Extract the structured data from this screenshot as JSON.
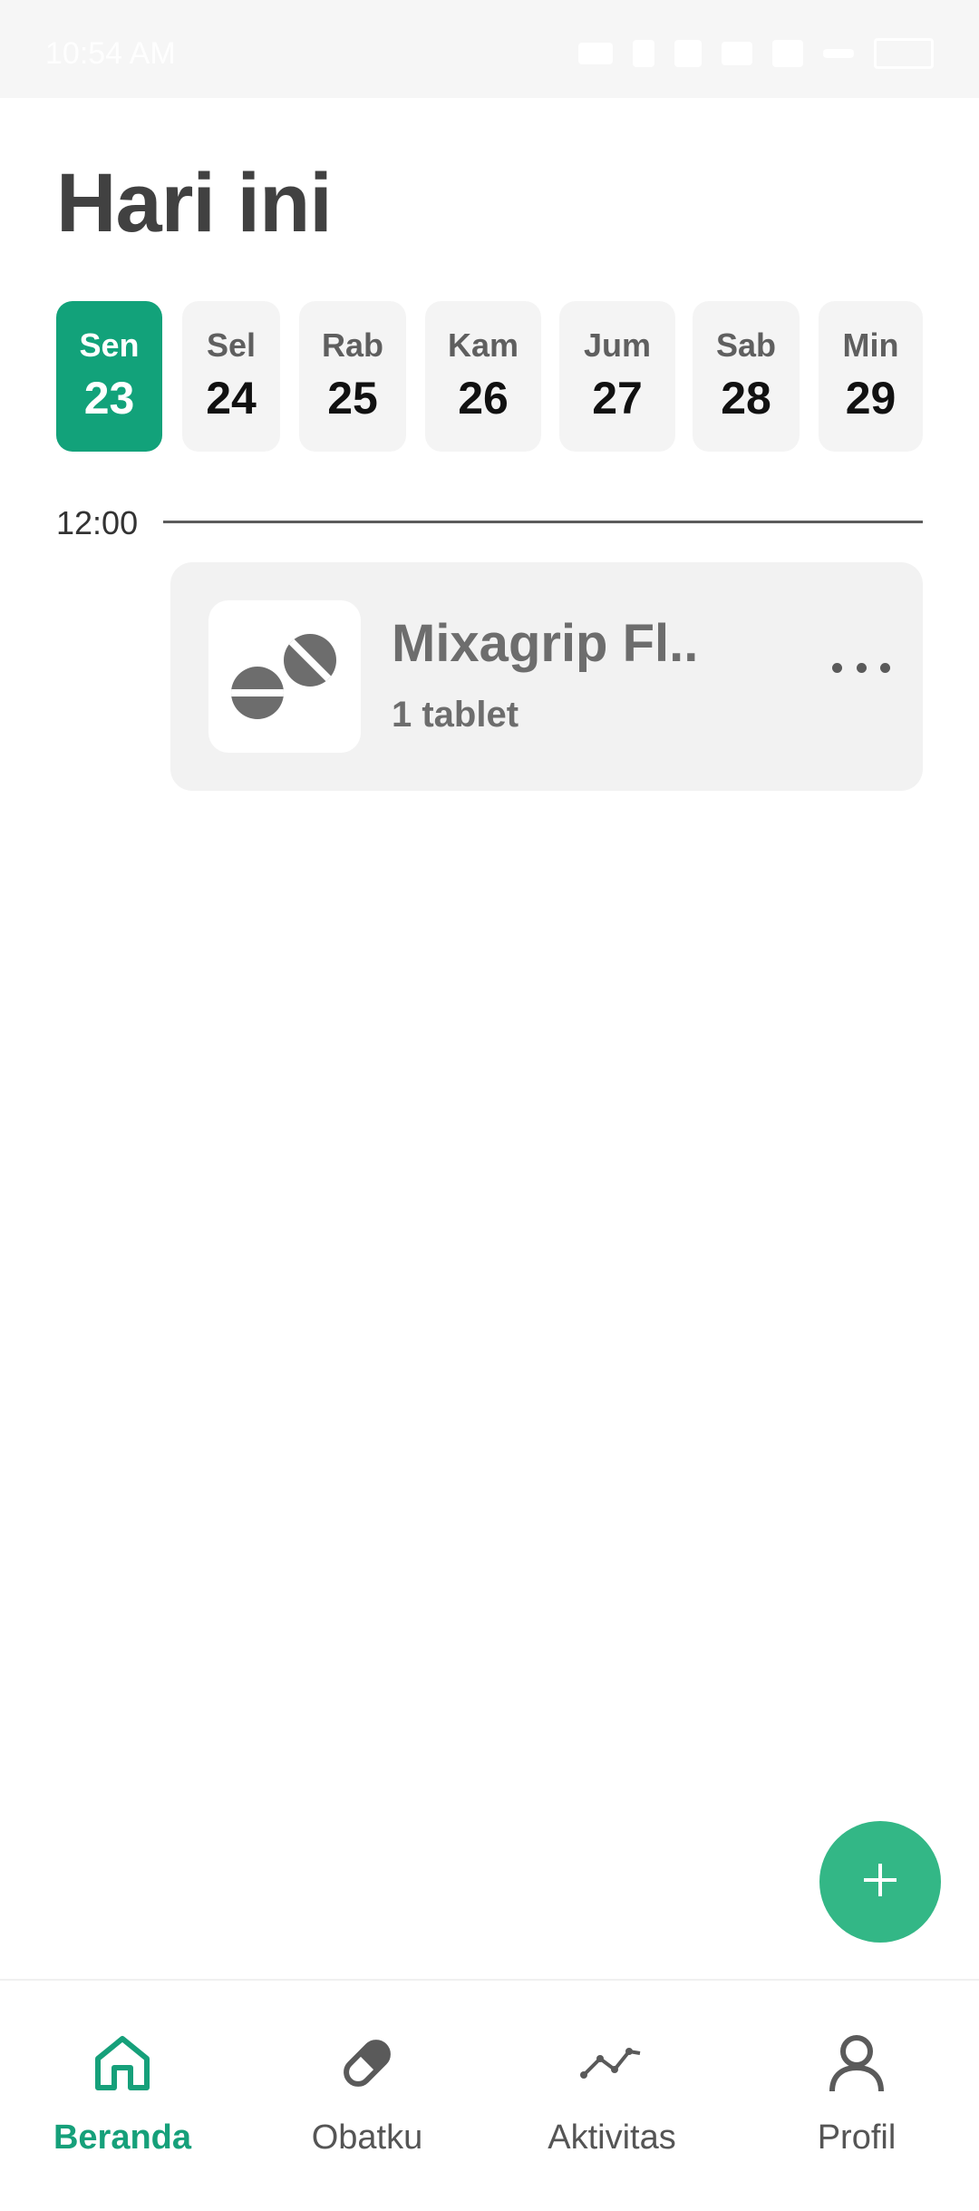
{
  "status_bar": {
    "time": "10:54 AM"
  },
  "header": {
    "title": "Hari ini"
  },
  "days": [
    {
      "name": "Sen",
      "num": "23",
      "active": true
    },
    {
      "name": "Sel",
      "num": "24",
      "active": false
    },
    {
      "name": "Rab",
      "num": "25",
      "active": false
    },
    {
      "name": "Kam",
      "num": "26",
      "active": false
    },
    {
      "name": "Jum",
      "num": "27",
      "active": false
    },
    {
      "name": "Sab",
      "num": "28",
      "active": false
    },
    {
      "name": "Min",
      "num": "29",
      "active": false
    }
  ],
  "schedule": {
    "time": "12:00",
    "medication": {
      "name": "Mixagrip Fl..",
      "dose": "1 tablet",
      "icon": "pills-icon",
      "more_icon": "more-horizontal-icon"
    }
  },
  "fab": {
    "icon": "plus-icon"
  },
  "bottom_nav": [
    {
      "label": "Beranda",
      "icon": "home-icon",
      "active": true
    },
    {
      "label": "Obatku",
      "icon": "pill-icon",
      "active": false
    },
    {
      "label": "Aktivitas",
      "icon": "activity-icon",
      "active": false
    },
    {
      "label": "Profil",
      "icon": "user-icon",
      "active": false
    }
  ],
  "colors": {
    "accent": "#12a27a",
    "fab": "#33b786",
    "card_bg": "#f2f2f2",
    "chip_bg": "#f4f4f4"
  }
}
